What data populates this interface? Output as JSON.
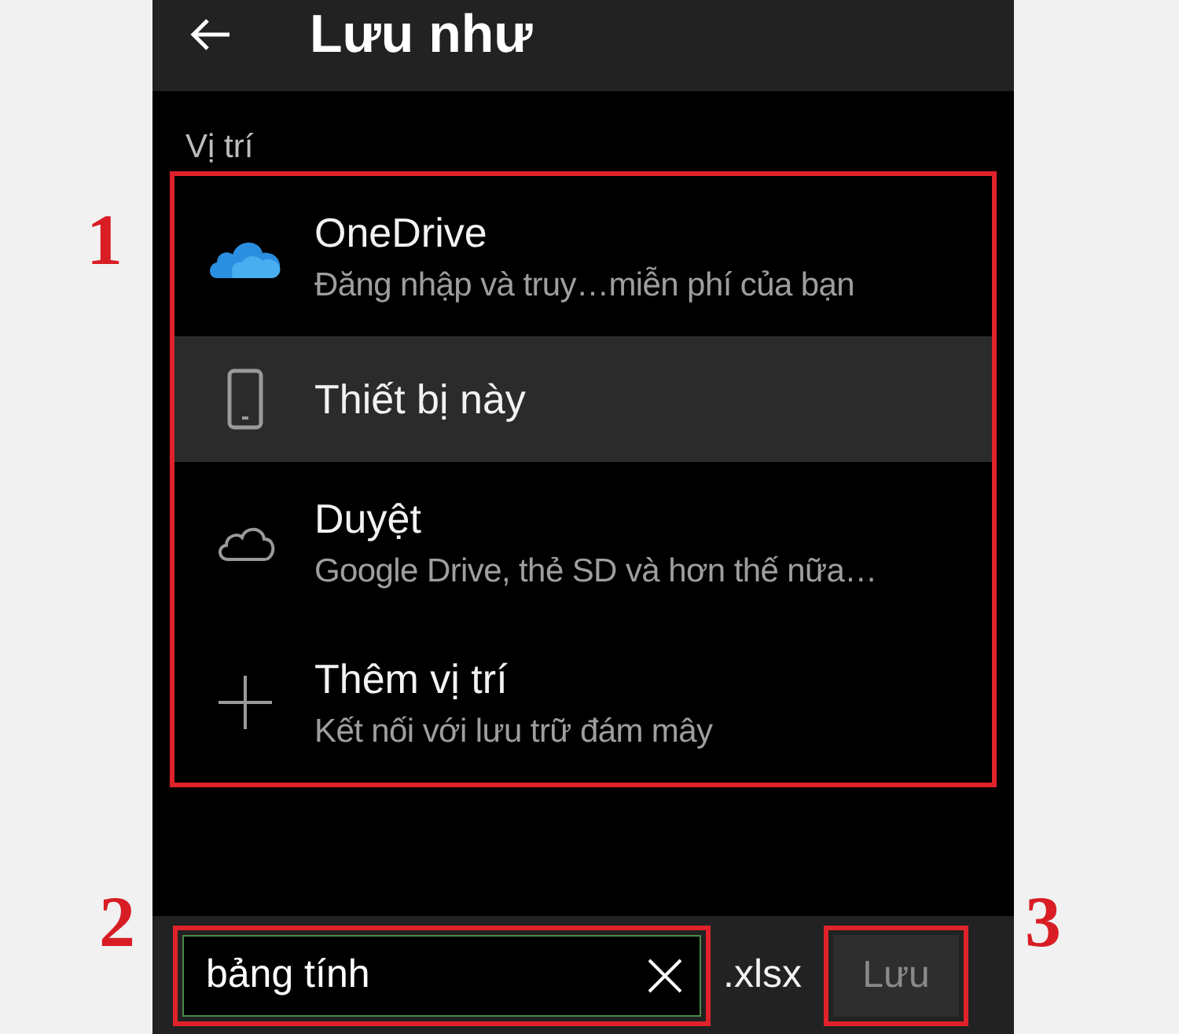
{
  "header": {
    "title": "Lưu như"
  },
  "section_label": "Vị trí",
  "locations": [
    {
      "kind": "onedrive",
      "title": "OneDrive",
      "subtitle": "Đăng nhập và truy…miễn phí của bạn",
      "selected": false
    },
    {
      "kind": "phone",
      "title": "Thiết bị này",
      "selected": true
    },
    {
      "kind": "cloud",
      "title": "Duyệt",
      "subtitle": "Google Drive, thẻ SD và hơn thế nữa…",
      "selected": false
    },
    {
      "kind": "plus",
      "title": "Thêm vị trí",
      "subtitle": "Kết nối với lưu trữ đám mây",
      "selected": false
    }
  ],
  "filename": {
    "value": "bảng tính",
    "extension": ".xlsx"
  },
  "save_button": {
    "label": "Lưu",
    "disabled": true
  },
  "annotations": [
    "1",
    "2",
    "3"
  ]
}
